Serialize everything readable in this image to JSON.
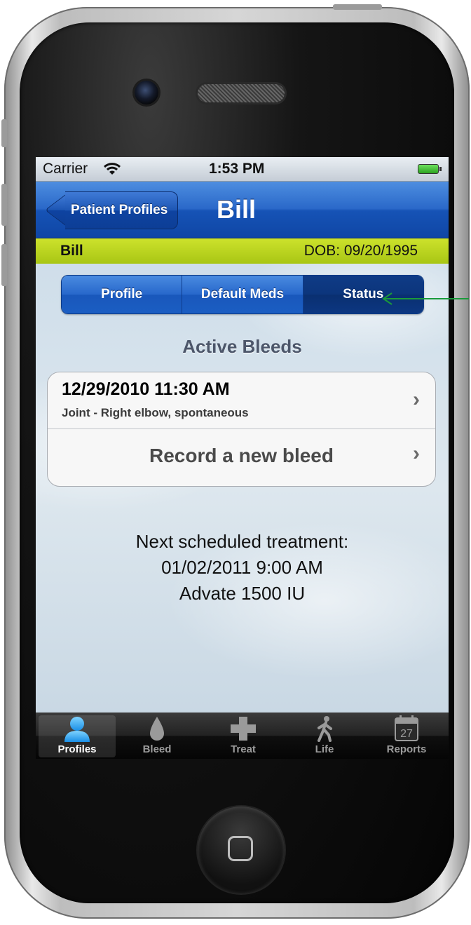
{
  "status_bar": {
    "carrier": "Carrier",
    "time": "1:53 PM"
  },
  "nav": {
    "back_label": "Patient Profiles",
    "title": "Bill"
  },
  "patient": {
    "name": "Bill",
    "dob": "DOB: 09/20/1995"
  },
  "segments": [
    {
      "label": "Profile",
      "selected": false
    },
    {
      "label": "Default Meds",
      "selected": false
    },
    {
      "label": "Status",
      "selected": true
    }
  ],
  "active_bleeds": {
    "heading": "Active Bleeds",
    "items": [
      {
        "date": "12/29/2010 11:30 AM",
        "description": "Joint - Right elbow, spontaneous"
      }
    ],
    "record_label": "Record a new bleed"
  },
  "next_treatment": {
    "label": "Next scheduled treatment:",
    "datetime": "01/02/2011 9:00 AM",
    "medication": "Advate 1500 IU"
  },
  "tabs": [
    {
      "label": "Profiles",
      "icon": "person-icon",
      "selected": true
    },
    {
      "label": "Bleed",
      "icon": "drop-icon",
      "selected": false
    },
    {
      "label": "Treat",
      "icon": "cross-icon",
      "selected": false
    },
    {
      "label": "Life",
      "icon": "walking-person-icon",
      "selected": false
    },
    {
      "label": "Reports",
      "icon": "calendar-icon",
      "selected": false,
      "calendar_day": "27"
    }
  ],
  "colors": {
    "nav_blue": "#1653b6",
    "patient_strip": "#b8d41c",
    "segment_selected": "#0c357c",
    "annotation_arrow": "#1a9a3a"
  }
}
